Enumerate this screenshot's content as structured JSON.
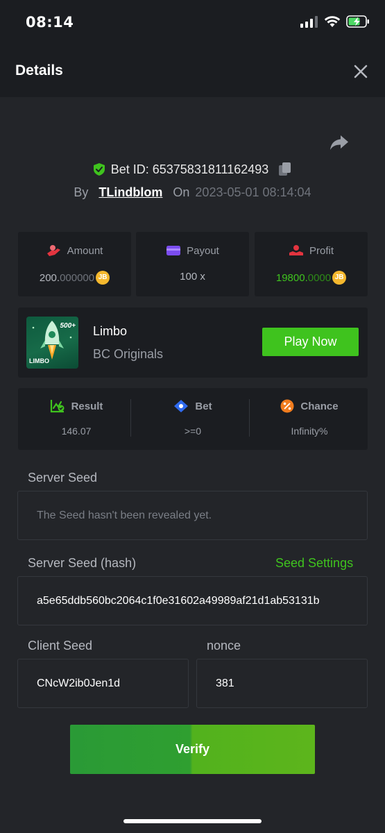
{
  "status_bar": {
    "time": "08:14"
  },
  "header": {
    "title": "Details"
  },
  "bet": {
    "id_label": "Bet ID: 65375831811162493",
    "by_label": "By",
    "user": "TLindblom",
    "on_label": "On",
    "date": "2023-05-01 08:14:04"
  },
  "stats": {
    "amount": {
      "label": "Amount",
      "value_main": "200.",
      "value_dim": "000000"
    },
    "payout": {
      "label": "Payout",
      "value": "100 x"
    },
    "profit": {
      "label": "Profit",
      "value_main": "19800.",
      "value_dim": "0000"
    }
  },
  "coin_symbol": "JB",
  "game": {
    "name": "Limbo",
    "provider": "BC Originals",
    "play_label": "Play Now",
    "thumb_badge": "500+",
    "thumb_title": "LIMBO"
  },
  "results": {
    "result": {
      "label": "Result",
      "value": "146.07"
    },
    "bet": {
      "label": "Bet",
      "value": ">=0"
    },
    "chance": {
      "label": "Chance",
      "value": "Infinity%"
    }
  },
  "server_seed": {
    "label": "Server Seed",
    "value": "The Seed hasn't been revealed yet."
  },
  "server_seed_hash": {
    "label": "Server Seed (hash)",
    "settings_label": "Seed Settings",
    "value": "a5e65ddb560bc2064c1f0e31602a49989af21d1ab53131b"
  },
  "client_seed": {
    "label": "Client Seed",
    "value": "CNcW2ib0Jen1d"
  },
  "nonce": {
    "label": "nonce",
    "value": "381"
  },
  "verify_label": "Verify",
  "colors": {
    "background": "#232529",
    "panel": "#1b1d21",
    "accent_green": "#3fc31e",
    "coin_gold": "#f5b82e",
    "payout_purple": "#7b4cf0",
    "profit_red": "#e3343f",
    "bet_blue": "#2f6bf0",
    "chance_orange": "#f07c1e"
  },
  "icons": {
    "signal": "signal-icon",
    "wifi": "wifi-icon",
    "battery": "battery-charging-icon",
    "close": "close-icon",
    "share": "share-icon",
    "shield": "shield-check-icon",
    "copy": "copy-icon",
    "amount": "hand-coin-icon",
    "payout": "wallet-icon",
    "profit": "profit-hand-icon",
    "result": "chart-check-icon",
    "bet": "ticket-icon",
    "chance": "percent-icon"
  }
}
